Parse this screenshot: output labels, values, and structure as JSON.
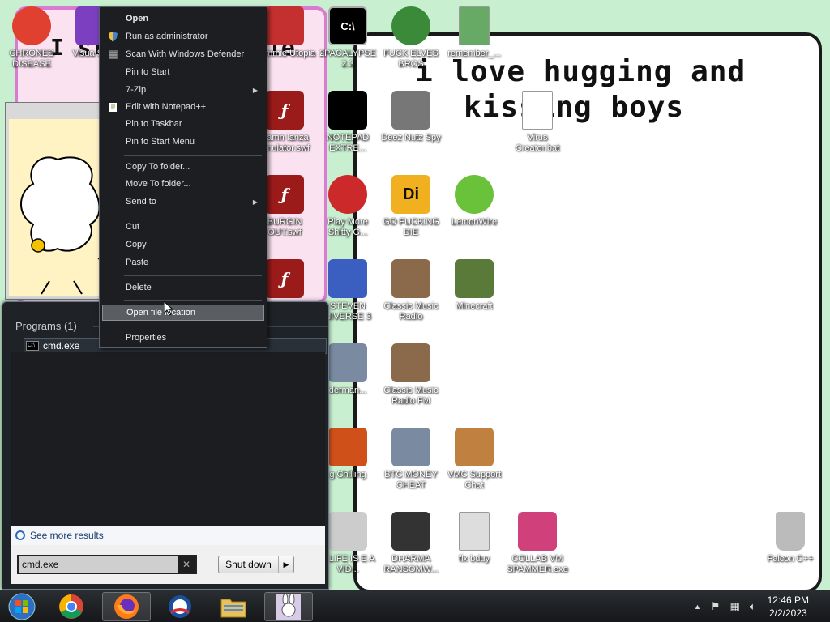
{
  "wallpaper": {
    "line1": "i love hugging and",
    "line2": "kissing boys",
    "left_text_1": "I stil",
    "left_text_2": "ie"
  },
  "desktop_icons": [
    {
      "label": "CHRONES DISEASE",
      "icon": "chrome-icon",
      "color": "#e04030"
    },
    {
      "label": "Visua Stupi",
      "icon": "visual-studio-icon",
      "color": "#7b3fbf"
    },
    {
      "label": "Commie Utopia",
      "icon": "app-icon",
      "color": "#c43030"
    },
    {
      "label": "2PACALYPSE 2.3",
      "icon": "cmd-icon",
      "color": "#000000"
    },
    {
      "label": "FUCK ELVES BROS",
      "icon": "elf-icon",
      "color": "#3a8a3a"
    },
    {
      "label": "remember_...",
      "icon": "file-icon",
      "color": "#66aa66"
    },
    {
      "label": "Damn Ianza emulator.swf",
      "icon": "flash-icon",
      "color": "#9b1b1b"
    },
    {
      "label": "NOTEPAD EXTRE...",
      "icon": "notepad-icon",
      "color": "#000000"
    },
    {
      "label": "Deez Nutz Spy",
      "icon": "windows-icon",
      "color": "#777777"
    },
    {
      "label": "Virus Creator.bat",
      "icon": "text-file-icon",
      "color": "#ffffff"
    },
    {
      "label": "BURGIN OUT.swf",
      "icon": "flash-icon",
      "color": "#9b1b1b"
    },
    {
      "label": "Play More Shitty G...",
      "icon": "popcap-icon",
      "color": "#cc2a2a"
    },
    {
      "label": "GO FUCKING DIE",
      "icon": "die-icon",
      "color": "#f0b020"
    },
    {
      "label": "LemonWire",
      "icon": "lemonwire-icon",
      "color": "#6ac23a"
    },
    {
      "label": "",
      "icon": "flash-icon",
      "color": "#9b1b1b"
    },
    {
      "label": "STEVEN NIVERSE 3",
      "icon": "steven-icon",
      "color": "#3a5fc0"
    },
    {
      "label": "Classic Music Radio",
      "icon": "portrait-icon",
      "color": "#8a6a4a"
    },
    {
      "label": "Minecraft",
      "icon": "minecraft-icon",
      "color": "#5a7a3a"
    },
    {
      "label": "derman...",
      "icon": "diamond-icon",
      "color": "#7a8aa0"
    },
    {
      "label": "Classic Music Radio FM",
      "icon": "portrait-icon",
      "color": "#8a6a4a"
    },
    {
      "label": "g Chilling",
      "icon": "game-icon",
      "color": "#d0501a"
    },
    {
      "label": "BTC MONEY CHEAT",
      "icon": "diamond-icon",
      "color": "#7a8aa0"
    },
    {
      "label": "VMC Support Chat",
      "icon": "support-icon",
      "color": "#c08040"
    },
    {
      "label": "Y LIFE IS E A VID...",
      "icon": "gamepad-icon",
      "color": "#cccccc"
    },
    {
      "label": "DHARMA RANSOMW...",
      "icon": "skull-icon",
      "color": "#333333"
    },
    {
      "label": "fix bduy",
      "icon": "script-icon",
      "color": "#dddddd"
    },
    {
      "label": "COLLAB VM SPAMMER.exe",
      "icon": "spammer-icon",
      "color": "#d0407a"
    },
    {
      "label": "Falcon C++",
      "icon": "recycle-bin-icon",
      "color": "#bbbbbb"
    }
  ],
  "context_menu": {
    "items": [
      {
        "label": "Open",
        "bold": true
      },
      {
        "label": "Run as administrator",
        "icon": "shield-icon"
      },
      {
        "label": "Scan With Windows Defender",
        "icon": "defender-icon"
      },
      {
        "label": "Pin to Start"
      },
      {
        "label": "7-Zip",
        "submenu": true
      },
      {
        "label": "Edit with Notepad++",
        "icon": "notepadpp-icon"
      },
      {
        "label": "Pin to Taskbar"
      },
      {
        "label": "Pin to Start Menu"
      },
      {
        "label": "Copy To folder..."
      },
      {
        "label": "Move To folder..."
      },
      {
        "label": "Send to",
        "submenu": true
      },
      {
        "label": "Cut"
      },
      {
        "label": "Copy"
      },
      {
        "label": "Paste"
      },
      {
        "label": "Delete"
      },
      {
        "label": "Open file location",
        "highlighted": true
      },
      {
        "label": "Properties"
      }
    ]
  },
  "start_menu": {
    "programs_heading": "Programs (1)",
    "program_item": "cmd.exe",
    "see_more": "See more results",
    "search_value": "cmd.exe",
    "clear_label": "✕",
    "shutdown_label": "Shut down",
    "shutdown_arrow": "▶"
  },
  "taskbar": {
    "buttons": [
      {
        "name": "start-orb",
        "icon": "windows-orb-icon"
      },
      {
        "name": "chrome",
        "icon": "chrome-icon"
      },
      {
        "name": "firefox",
        "icon": "firefox-icon"
      },
      {
        "name": "obama",
        "icon": "obama-logo-icon"
      },
      {
        "name": "explorer",
        "icon": "folder-icon"
      },
      {
        "name": "bunny-app",
        "icon": "bunny-icon"
      }
    ],
    "time": "12:46 PM",
    "date": "2/2/2023",
    "tray_up_arrow": "▲"
  }
}
